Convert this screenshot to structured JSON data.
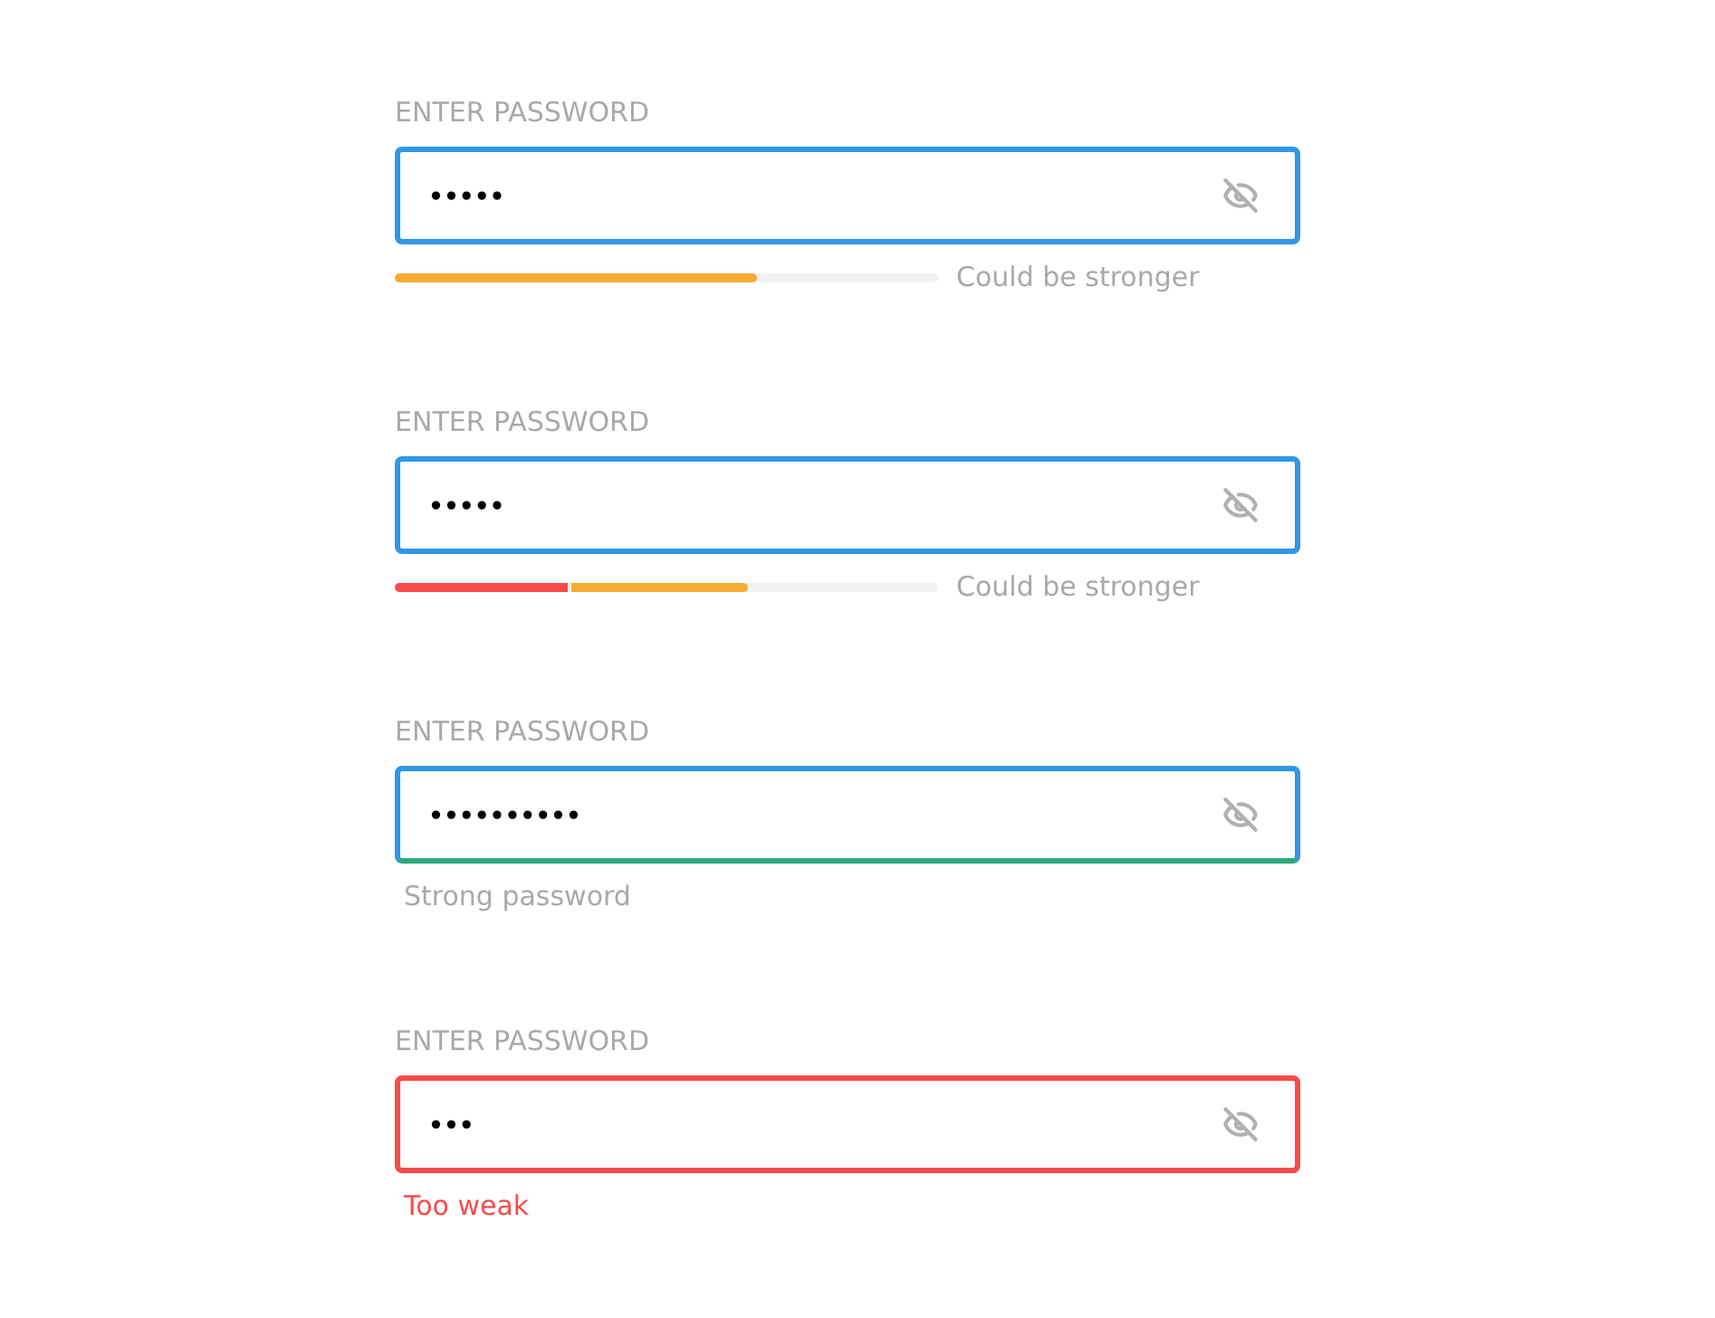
{
  "fields": [
    {
      "label": "ENTER PASSWORD",
      "value": "•••••",
      "strong": false,
      "too_weak": false,
      "meter": {
        "level": 0.667,
        "segments": [
          {
            "color": "#f7ab33"
          }
        ]
      },
      "message": "Could be stronger"
    },
    {
      "label": "ENTER PASSWORD",
      "value": "•••••",
      "strong": false,
      "too_weak": false,
      "meter": {
        "level": 0.65,
        "segments": [
          {
            "color": "#f94a4a"
          },
          {
            "color": "#f7ab33"
          }
        ]
      },
      "message": "Could be stronger"
    },
    {
      "label": "ENTER PASSWORD",
      "value": "••••••••••",
      "strong": true,
      "too_weak": false,
      "message": "Strong password"
    },
    {
      "label": "ENTER PASSWORD",
      "value": "•••",
      "strong": false,
      "too_weak": true,
      "message": "Too weak"
    }
  ]
}
